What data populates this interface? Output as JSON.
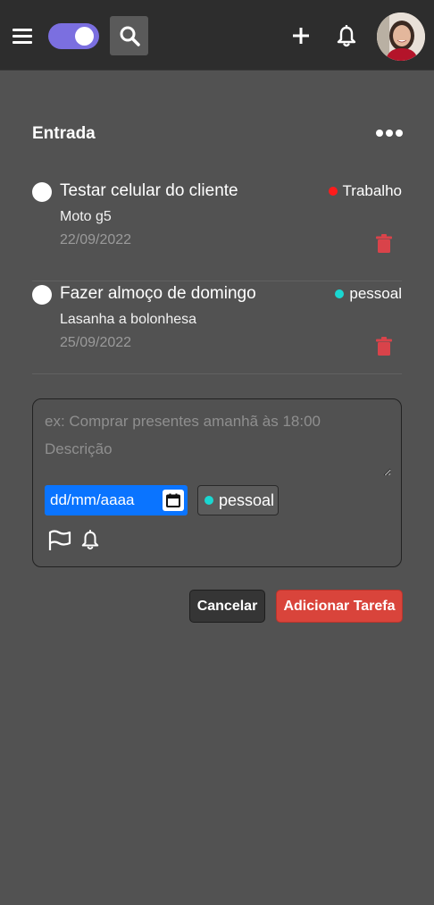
{
  "header": {
    "menu_icon": "hamburger-icon",
    "toggle_state": "on",
    "search_icon": "search-icon",
    "add_icon": "plus-icon",
    "notifications_icon": "bell-icon",
    "avatar_icon": "user-avatar"
  },
  "section": {
    "title": "Entrada",
    "more_icon": "ellipsis-icon"
  },
  "tasks": [
    {
      "title": "Testar celular do cliente",
      "description": "Moto g5",
      "date": "22/09/2022",
      "tag": "Trabalho",
      "tag_color": "#ff1b1b"
    },
    {
      "title": "Fazer almoço de domingo",
      "description": "Lasanha a bolonhesa",
      "date": "25/09/2022",
      "tag": "pessoal",
      "tag_color": "#1ad7d1"
    }
  ],
  "form": {
    "title_placeholder": "ex: Comprar presentes amanhã às 18:00",
    "description_placeholder": "Descrição",
    "date_value": "dd/mm/aaaa",
    "tag_label": "pessoal",
    "tag_color": "#1ad7d1",
    "cancel_label": "Cancelar",
    "submit_label": "Adicionar Tarefa"
  },
  "colors": {
    "background": "#525252",
    "header": "#2d2d2d",
    "accent": "#7b6fe0",
    "danger": "#d9443b",
    "date_input": "#0a74ff"
  }
}
